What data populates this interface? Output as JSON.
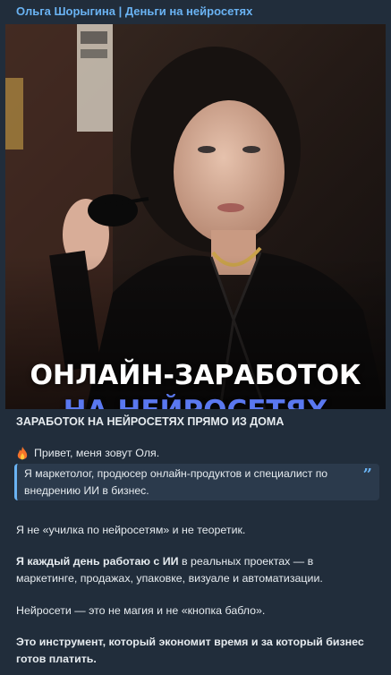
{
  "channel": {
    "title": "Ольга Шорыгина | Деньги на нейросетях"
  },
  "hero": {
    "title_line1": "ОНЛАЙН-ЗАРАБОТОК",
    "title_line2": "НА НЕЙРОСЕТЯХ",
    "title_line2_color": "#5a78f0"
  },
  "message": {
    "headline": "ЗАРАБОТОК НА НЕЙРОСЕТЯХ ПРЯМО ИЗ ДОМА",
    "greeting": "Привет, меня зовут Оля.",
    "greeting_icon": "fire-icon",
    "quote": "Я маркетолог, продюсер онлайн-продуктов и специалист по внедрению ИИ в бизнес.",
    "p1": "Я не «училка по нейросетям» и не теоретик.",
    "p2_bold": "Я каждый день работаю с ИИ",
    "p2_rest": " в реальных проектах — в маркетинге, продажах, упаковке, визуале и автоматизации.",
    "p3": "Нейросети — это не магия и не «кнопка бабло».",
    "p4": "Это инструмент, который экономит время и за который бизнес готов платить."
  },
  "colors": {
    "accent": "#6ab3f3",
    "background": "#212d3b",
    "quote_background": "#2b3a4c"
  }
}
